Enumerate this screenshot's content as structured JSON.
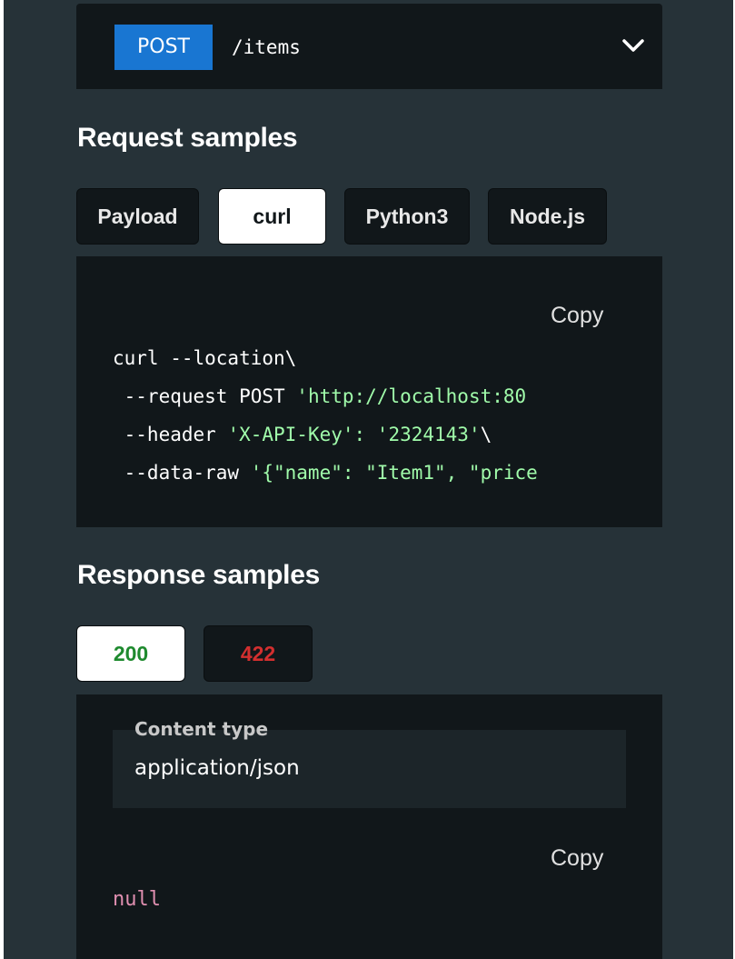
{
  "endpoint": {
    "method": "POST",
    "path": "/items",
    "toggle_icon": "chevron-down-icon"
  },
  "request_samples": {
    "title": "Request samples",
    "tabs": [
      {
        "label": "Payload",
        "active": false
      },
      {
        "label": "curl",
        "active": true
      },
      {
        "label": "Python3",
        "active": false
      },
      {
        "label": "Node.js",
        "active": false
      }
    ],
    "copy_label": "Copy",
    "code": {
      "line1": "curl --location\\",
      "line2_cmd": " --request POST ",
      "line2_str": "'http://localhost:80",
      "line3_cmd": " --header ",
      "line3_str": "'X-API-Key': '2324143'",
      "line3_tail": "\\",
      "line4_cmd": " --data-raw ",
      "line4_str": "'{\"name\": \"Item1\", \"price"
    }
  },
  "response_samples": {
    "title": "Response samples",
    "tabs": [
      {
        "label": "200",
        "active": true,
        "color": "#1e8a2e"
      },
      {
        "label": "422",
        "active": false,
        "color": "#d32f2f"
      }
    ],
    "content_type_label": "Content type",
    "content_type_value": "application/json",
    "copy_label": "Copy",
    "body": "null"
  },
  "colors": {
    "panel_bg": "#263238",
    "code_bg": "#11171a",
    "method_badge": "#1976d2",
    "string": "#a0fbaa",
    "null_keyword": "#e08fb0"
  }
}
